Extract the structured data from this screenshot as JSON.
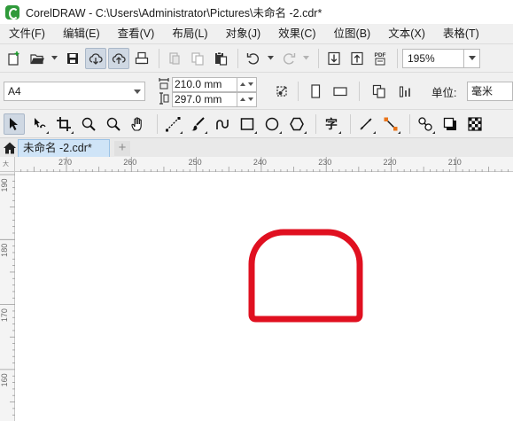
{
  "window": {
    "title": "CorelDRAW - C:\\Users\\Administrator\\Pictures\\未命名 -2.cdr*"
  },
  "menu": [
    "文件(F)",
    "编辑(E)",
    "查看(V)",
    "布局(L)",
    "对象(J)",
    "效果(C)",
    "位图(B)",
    "文本(X)",
    "表格(T)"
  ],
  "toolbar": {
    "pdf_label": "PDF",
    "zoom_value": "195%"
  },
  "property_bar": {
    "page_size": "A4",
    "width": "210.0 mm",
    "height": "297.0 mm",
    "units_label": "单位:",
    "units_value": "毫米"
  },
  "toolbox": {
    "text_tool_glyph": "字"
  },
  "tabs": {
    "document_tab": "未命名 -2.cdr*",
    "new_tab": "+"
  },
  "rulers": {
    "horizontal_labels": [
      "270",
      "260",
      "250",
      "240",
      "230",
      "220",
      "210"
    ],
    "vertical_labels": [
      "190",
      "180",
      "170",
      "160"
    ],
    "corner_label": "大"
  },
  "drawing": {
    "stroke_color": "#e01020",
    "fill_color": "#ffffff"
  }
}
